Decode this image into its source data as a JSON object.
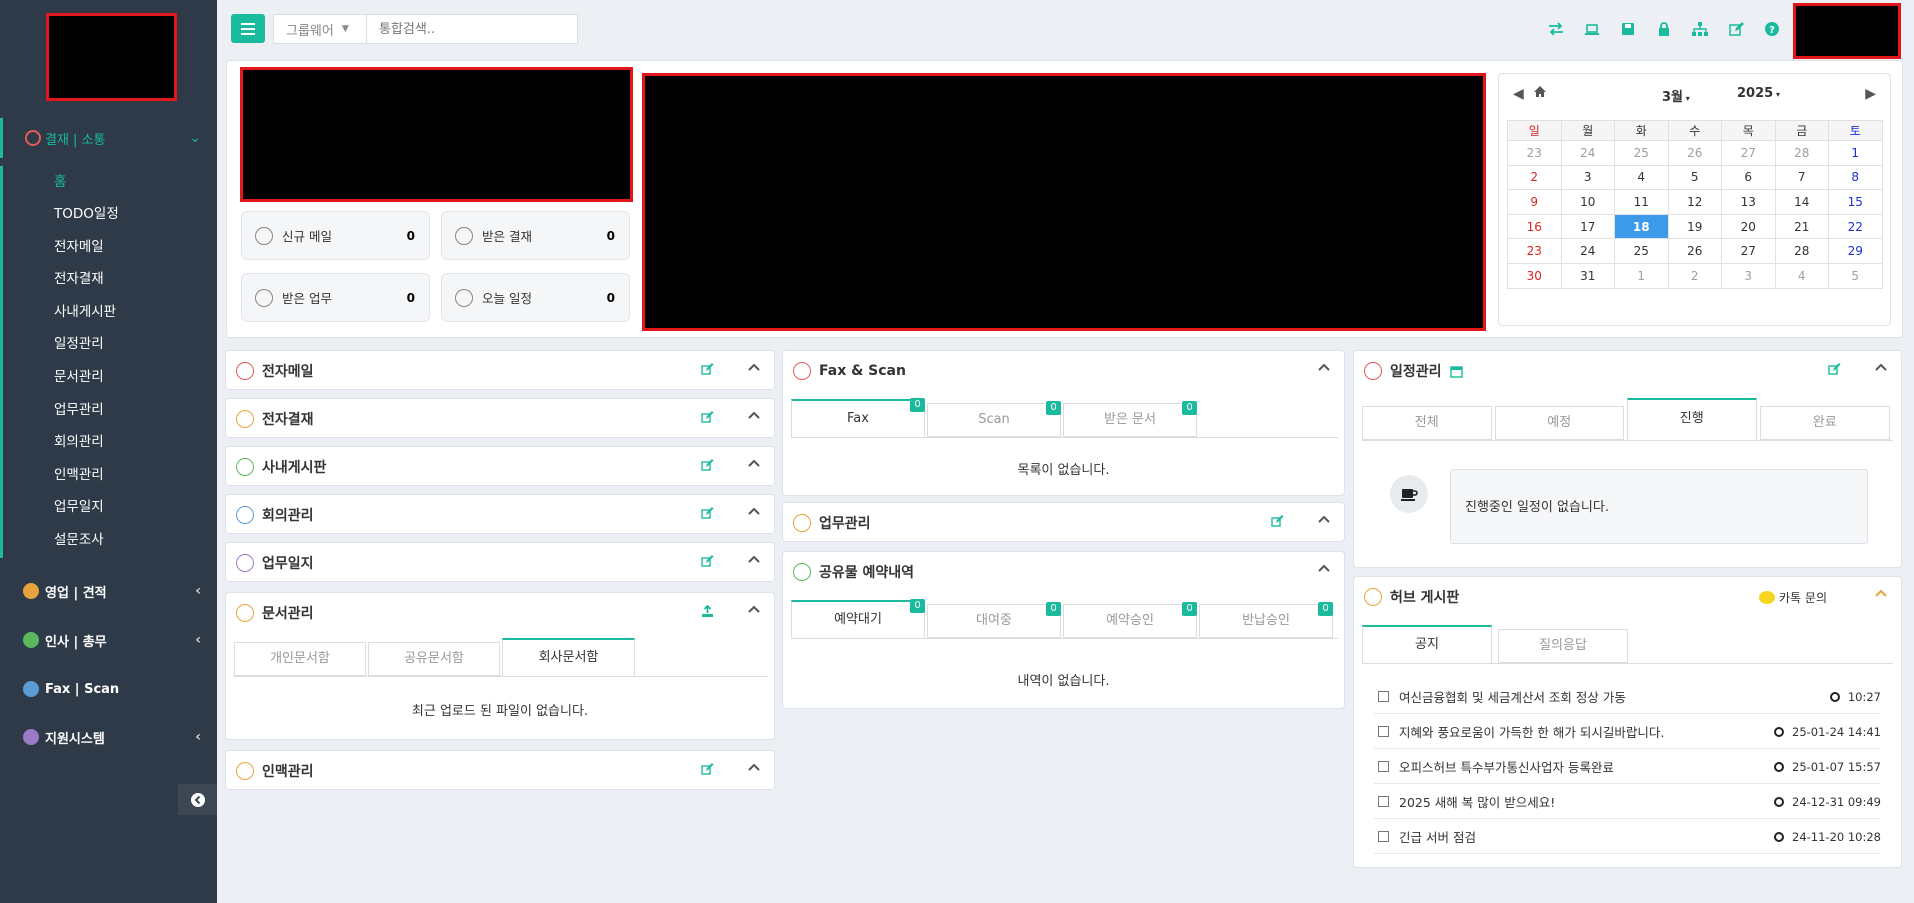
{
  "sidebar": {
    "head_label": "결재 | 소통",
    "sub_items": [
      "홈",
      "TODO일정",
      "전자메일",
      "전자결재",
      "사내게시판",
      "일정관리",
      "문서관리",
      "업무관리",
      "회의관리",
      "인맥관리",
      "업무일지",
      "설문조사"
    ],
    "groups": [
      "영업 | 견적",
      "인사 | 총무",
      "Fax | Scan",
      "지원시스템"
    ]
  },
  "topbar": {
    "group_select": "그룹웨어",
    "search_placeholder": "통합검색.."
  },
  "stats": [
    {
      "label": "신규 메일",
      "value": "0"
    },
    {
      "label": "받은 결재",
      "value": "0"
    },
    {
      "label": "받은 업무",
      "value": "0"
    },
    {
      "label": "오늘 일정",
      "value": "0"
    }
  ],
  "calendar": {
    "month": "3월",
    "year": "2025",
    "weekdays": [
      "일",
      "월",
      "화",
      "수",
      "목",
      "금",
      "토"
    ],
    "weeks": [
      [
        "23",
        "24",
        "25",
        "26",
        "27",
        "28",
        "1"
      ],
      [
        "2",
        "3",
        "4",
        "5",
        "6",
        "7",
        "8"
      ],
      [
        "9",
        "10",
        "11",
        "12",
        "13",
        "14",
        "15"
      ],
      [
        "16",
        "17",
        "18",
        "19",
        "20",
        "21",
        "22"
      ],
      [
        "23",
        "24",
        "25",
        "26",
        "27",
        "28",
        "29"
      ],
      [
        "30",
        "31",
        "1",
        "2",
        "3",
        "4",
        "5"
      ]
    ],
    "today": "18"
  },
  "left_panels": [
    "전자메일",
    "전자결재",
    "사내게시판",
    "회의관리",
    "업무일지",
    "문서관리",
    "인맥관리"
  ],
  "doc_tabs": [
    "개인문서함",
    "공유문서함",
    "회사문서함"
  ],
  "doc_empty": "최근 업로드 된 파일이 없습니다.",
  "fax": {
    "title": "Fax & Scan",
    "tabs": [
      {
        "label": "Fax",
        "count": "0"
      },
      {
        "label": "Scan",
        "count": "0"
      },
      {
        "label": "받은 문서",
        "count": "0"
      }
    ],
    "empty": "목록이 없습니다."
  },
  "task": {
    "title": "업무관리"
  },
  "reserve": {
    "title": "공유물 예약내역",
    "tabs": [
      {
        "label": "예약대기",
        "count": "0"
      },
      {
        "label": "대여중",
        "count": "0"
      },
      {
        "label": "예약승인",
        "count": "0"
      },
      {
        "label": "반납승인",
        "count": "0"
      }
    ],
    "empty": "내역이 없습니다."
  },
  "schedule": {
    "title": "일정관리",
    "tabs": [
      "전체",
      "예정",
      "진행",
      "완료"
    ],
    "empty": "진행중인 일정이 없습니다."
  },
  "hub": {
    "title": "허브 게시판",
    "kakao": "카톡 문의",
    "tabs": [
      "공지",
      "질의응답"
    ],
    "notices": [
      {
        "title": "여신금융협회 및 세금계산서 조회 정상 가동",
        "time": "10:27"
      },
      {
        "title": "지혜와 풍요로움이 가득한 한 해가 되시길바랍니다.",
        "time": "25-01-24 14:41"
      },
      {
        "title": "오피스허브 특수부가통신사업자 등록완료",
        "time": "25-01-07 15:57"
      },
      {
        "title": "2025 새해 복 많이 받으세요!",
        "time": "24-12-31 09:49"
      },
      {
        "title": "긴급 서버 점검",
        "time": "24-11-20 10:28"
      }
    ]
  },
  "colors": {
    "accent": "#1abb9c",
    "sidebar": "#2e3a47",
    "today": "#3b9ae9",
    "redact": "#e3161a"
  }
}
